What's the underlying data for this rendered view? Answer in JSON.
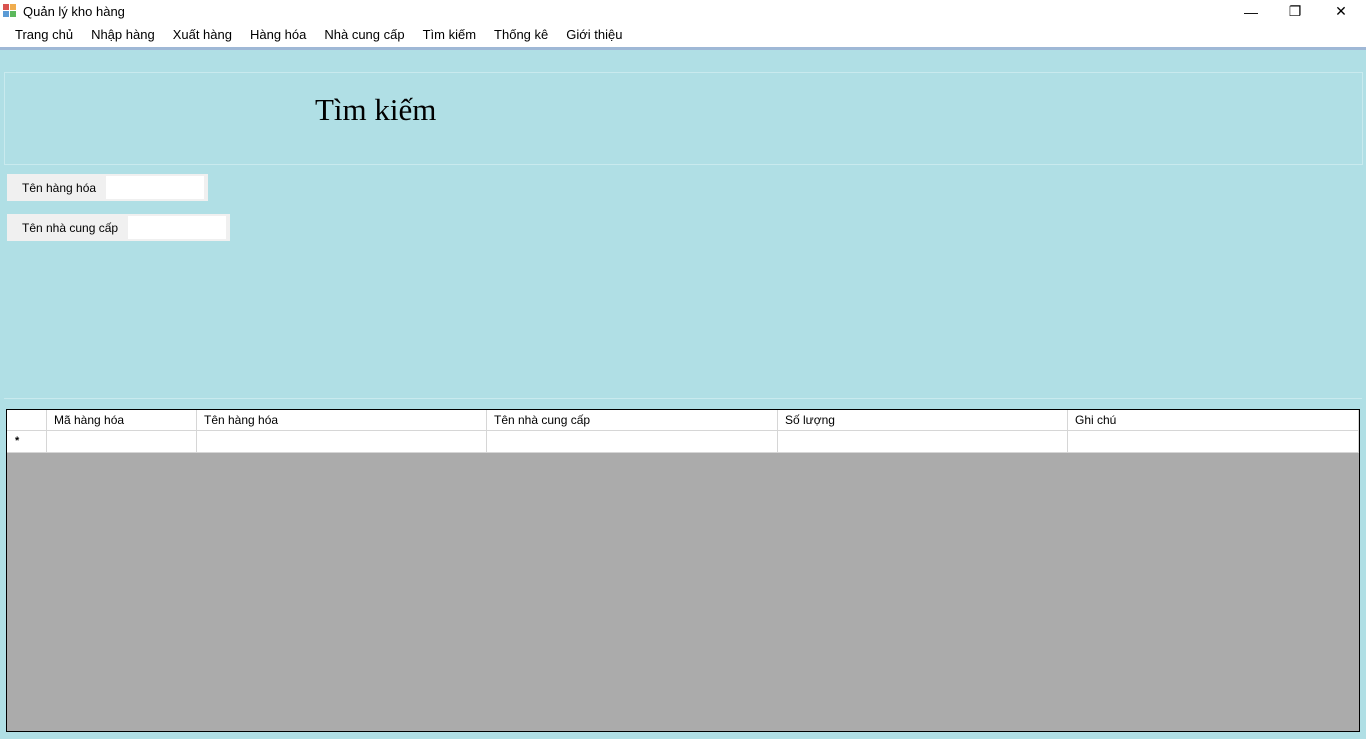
{
  "window": {
    "title": "Quản lý kho hàng",
    "minimize_glyph": "—",
    "restore_glyph": "❐",
    "close_glyph": "✕"
  },
  "menu": {
    "items": [
      {
        "label": "Trang chủ"
      },
      {
        "label": "Nhập hàng"
      },
      {
        "label": "Xuất hàng"
      },
      {
        "label": "Hàng hóa"
      },
      {
        "label": "Nhà cung cấp"
      },
      {
        "label": "Tìm kiếm"
      },
      {
        "label": "Thống kê"
      },
      {
        "label": "Giới thiệu"
      }
    ]
  },
  "page": {
    "title": "Tìm kiếm"
  },
  "search": {
    "product_name_label": "Tên hàng hóa",
    "product_name_value": "",
    "supplier_name_label": "Tên nhà cung cấp",
    "supplier_name_value": ""
  },
  "grid": {
    "columns": [
      "Mã hàng hóa",
      "Tên hàng hóa",
      "Tên nhà cung cấp",
      "Số lượng",
      "Ghi chú"
    ],
    "new_row_marker": "*"
  },
  "colors": {
    "background": "#b0dfe5",
    "grid_empty_area": "#ababab",
    "menu_separator": "#9fb8d6"
  }
}
